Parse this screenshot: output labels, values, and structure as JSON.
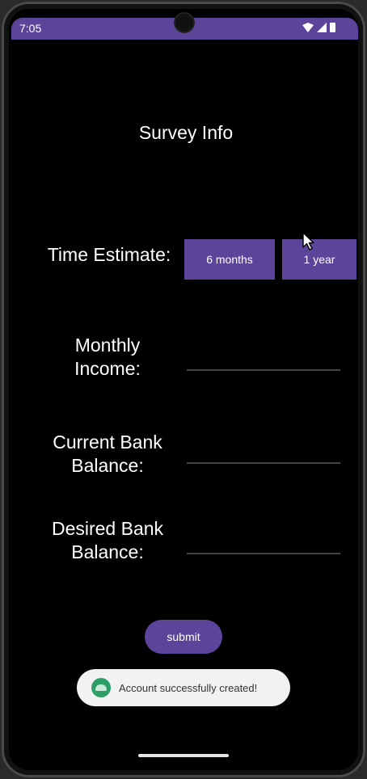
{
  "status_bar": {
    "time": "7:05"
  },
  "screen": {
    "title": "Survey Info"
  },
  "form": {
    "time_estimate_label": "Time Estimate:",
    "options": [
      {
        "label": "6 months"
      },
      {
        "label": "1 year"
      }
    ],
    "monthly_income_label": "Monthly Income:",
    "monthly_income_value": "",
    "current_balance_label": "Current Bank Balance:",
    "current_balance_value": "",
    "desired_balance_label": "Desired Bank Balance:",
    "desired_balance_value": "",
    "submit_label": "submit"
  },
  "toast": {
    "message": "Account successfully created!",
    "icon": "app-icon"
  },
  "colors": {
    "accent": "#5c449a",
    "background": "#000000",
    "toast_bg": "#f2f2f2"
  }
}
